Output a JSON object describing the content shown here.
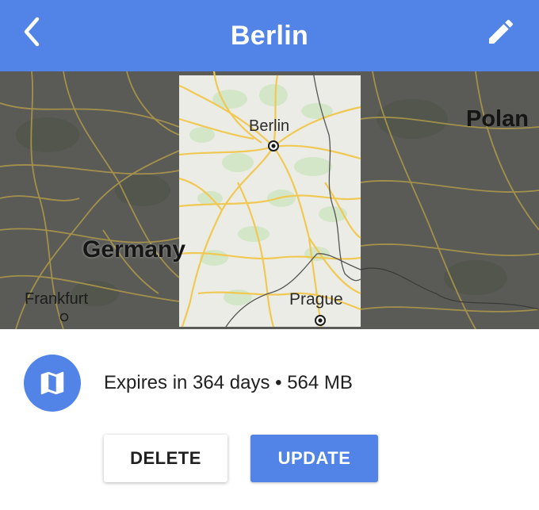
{
  "header": {
    "title": "Berlin",
    "back_icon": "chevron-left-icon",
    "edit_icon": "pencil-icon",
    "background_color": "#5284e8"
  },
  "map": {
    "labels": {
      "berlin": "Berlin",
      "poland": "Polan",
      "germany": "Germany",
      "frankfurt": "Frankfurt",
      "prague": "Prague"
    },
    "selected_area_color": "#ecece6",
    "outside_area_color": "#5a5a56",
    "road_color": "#f0c954"
  },
  "info": {
    "icon": "map-icon",
    "text": "Expires in 364 days • 564 MB"
  },
  "buttons": {
    "delete_label": "DELETE",
    "update_label": "UPDATE"
  }
}
